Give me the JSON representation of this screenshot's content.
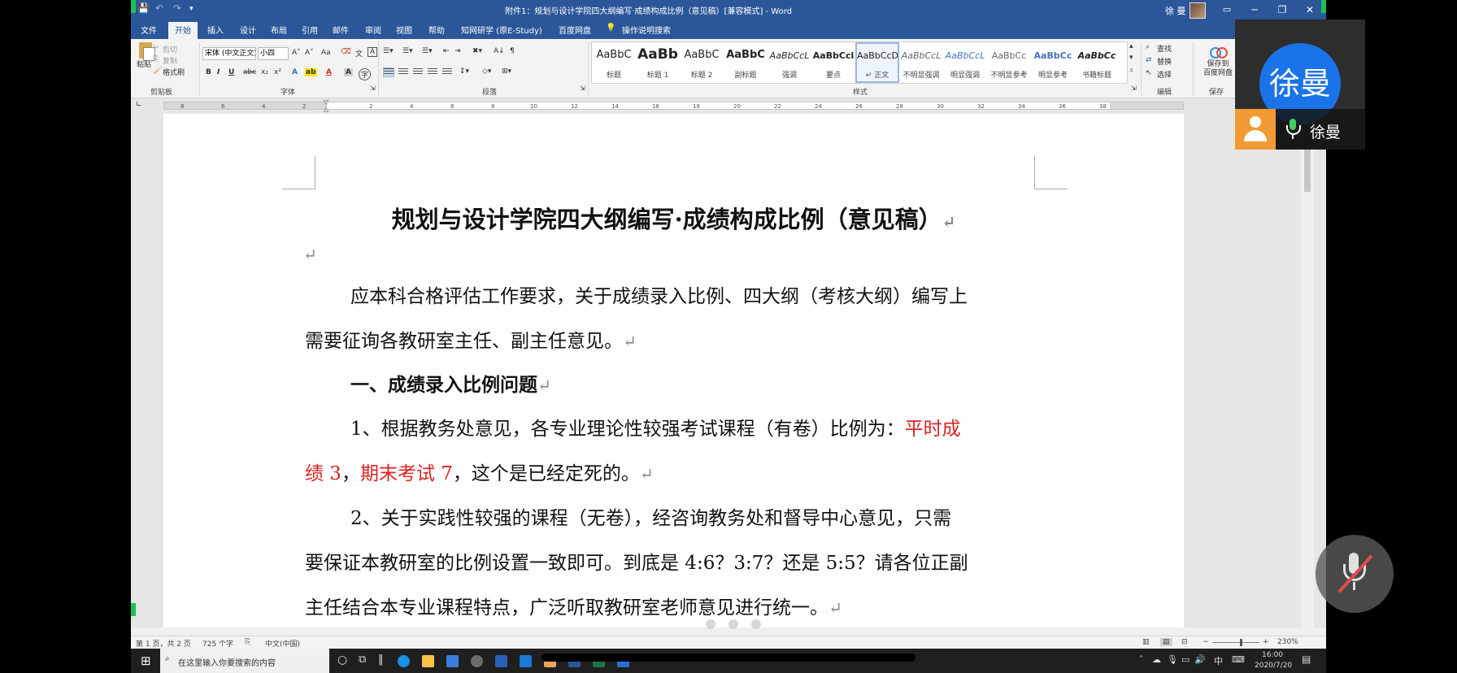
{
  "window": {
    "title": "附件1：规划与设计学院四大纲编写·成绩构成比例（意见稿）[兼容模式] - Word",
    "user_name": "徐 曼",
    "minimize": "─",
    "maximize": "❐",
    "close": "✕"
  },
  "tabs": [
    "文件",
    "开始",
    "插入",
    "设计",
    "布局",
    "引用",
    "邮件",
    "审阅",
    "视图",
    "帮助",
    "知网研学 (原E-Study)",
    "百度网盘"
  ],
  "tell_me": "操作说明搜索",
  "ribbon": {
    "clipboard": {
      "paste": "粘贴",
      "cut": "剪切",
      "copy": "复制",
      "format_painter": "格式刷",
      "label": "剪贴板"
    },
    "font": {
      "name": "宋体 (中文正文)",
      "size": "小四",
      "grow": "A˄",
      "shrink": "A˅",
      "case": "Aa",
      "bold": "B",
      "italic": "I",
      "underline": "U",
      "strike": "abc",
      "sub": "x₂",
      "sup": "x²",
      "color": "A",
      "label": "字体"
    },
    "paragraph": {
      "label": "段落"
    },
    "styles": {
      "label": "样式",
      "items": [
        {
          "sample": "AaBbC",
          "name": "标题"
        },
        {
          "sample": "AaBb",
          "name": "标题 1"
        },
        {
          "sample": "AaBbC",
          "name": "标题 2"
        },
        {
          "sample": "AaBbC",
          "name": "副标题"
        },
        {
          "sample": "AaBbCcL",
          "name": "强调"
        },
        {
          "sample": "AaBbCcl",
          "name": "要点"
        },
        {
          "sample": "AaBbCcD",
          "name": "↵ 正文"
        },
        {
          "sample": "AaBbCcL",
          "name": "不明显强调"
        },
        {
          "sample": "AaBbCcL",
          "name": "明显强调"
        },
        {
          "sample": "AaBbCc",
          "name": "不明显参考"
        },
        {
          "sample": "AaBbCc",
          "name": "明显参考"
        },
        {
          "sample": "AaBbCc",
          "name": "书籍标题"
        }
      ]
    },
    "editing": {
      "find": "查找",
      "replace": "替换",
      "select": "选择",
      "label": "编辑"
    },
    "save": {
      "button": "保存到\n百度网盘",
      "label": "保存"
    }
  },
  "ruler_ticks": [
    "8",
    "6",
    "4",
    "2",
    "2",
    "4",
    "6",
    "8",
    "10",
    "12",
    "14",
    "16",
    "18",
    "20",
    "22",
    "24",
    "26",
    "28",
    "30",
    "32",
    "34",
    "36",
    "38"
  ],
  "document": {
    "title": "规划与设计学院四大纲编写·成绩构成比例（意见稿）",
    "p1_line1": "应本科合格评估工作要求，关于成绩录入比例、四大纲（考核大纲）编写上",
    "p1_line2": "需要征询各教研室主任、副主任意见。",
    "h1": "一、成绩录入比例问题",
    "p2_line1_pre": "1、根据教务处意见，各专业理论性较强考试课程（有卷）比例为：",
    "p2_line1_red": "平时成",
    "p2_line2_red1": "绩 3",
    "p2_line2_sep": "，",
    "p2_line2_red2": "期末考试 7",
    "p2_line2_post": "，这个是已经定死的。",
    "p3_line1": "2、关于实践性较强的课程（无卷），经咨询教务处和督导中心意见，只需",
    "p3_line2": "要保证本教研室的比例设置一致即可。到底是 4:6？3:7？还是 5:5？请各位正副",
    "p3_line3": "主任结合本专业课程特点，广泛听取教研室老师意见进行统一。",
    "para_mark": "↵"
  },
  "statusbar": {
    "page": "第 1 页，共 2 页",
    "words": "725 个字",
    "language": "中文(中国)",
    "zoom": "230%"
  },
  "taskbar": {
    "search_placeholder": "在这里输入你要搜索的内容",
    "time": "16:00",
    "date": "2020/7/20",
    "ime": "中"
  },
  "call": {
    "avatar_text": "徐曼",
    "name": "徐曼"
  },
  "colors": {
    "word_blue": "#2b579a",
    "accent_red": "#dd2222",
    "call_blue": "#1a73e8",
    "call_orange": "#f29b34"
  }
}
